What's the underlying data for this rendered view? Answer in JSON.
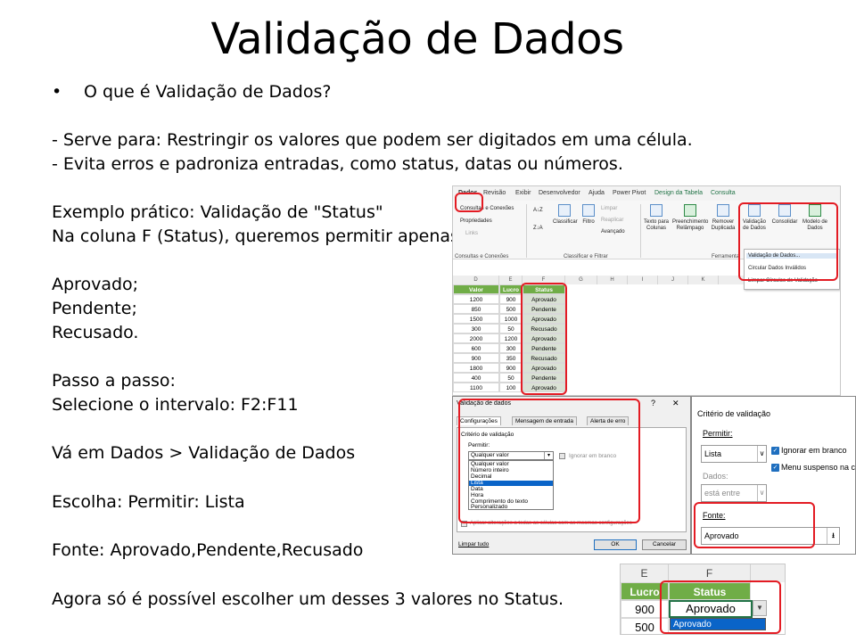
{
  "slide": {
    "title": "Validação de Dados",
    "bullet": "O que é Validação de Dados?",
    "lines": [
      "- Serve para: Restringir os valores que podem ser digitados em uma célula.",
      "- Evita erros e padroniza entradas, como status, datas ou números.",
      "Exemplo prático: Validação de \"Status\"",
      "Na coluna F (Status), queremos permitir apenas:",
      "Aprovado;",
      "Pendente;",
      "Recusado.",
      "Passo a passo:",
      "Selecione o intervalo: F2:F11",
      "Vá em Dados > Validação de Dados",
      "Escolha: Permitir: Lista",
      "Fonte: Aprovado,Pendente,Recusado",
      "Agora só é possível escolher um desses 3 valores no Status."
    ]
  },
  "ribbon": {
    "tabs": [
      "Dados",
      "Revisão",
      "Exibir",
      "Desenvolvedor",
      "Ajuda",
      "Power Pivot",
      "Design da Tabela",
      "Consulta"
    ],
    "items": {
      "consultas": "Consultas e Conexões",
      "propriedades": "Propriedades",
      "links": "Links",
      "classificar": "Classificar",
      "filtro": "Filtro",
      "limpar": "Limpar",
      "reaplicar": "Reaplicar",
      "avancado": "Avançado",
      "texto_colunas": "Texto para Colunas",
      "preenchimento": "Preenchimento Relâmpago",
      "remover": "Remover Duplicada",
      "validacao": "Validação de Dados",
      "consolidar": "Consolidar",
      "modelo": "Modelo de Dados",
      "sort_az": "A↓Z",
      "sort_za": "Z↓A"
    },
    "groups": {
      "consultas": "Consultas e Conexões",
      "classificar": "Classificar e Filtrar",
      "ferramentas": "Ferramenta"
    },
    "dropdown": [
      "Validação de Dados...",
      "Circular Dados Inválidos",
      "Limpar Círculos de Validação"
    ]
  },
  "sheet": {
    "columns": [
      "D",
      "E",
      "F",
      "G",
      "H",
      "I",
      "J",
      "K",
      "L"
    ],
    "headers": [
      "Valor",
      "Lucro",
      "Status"
    ],
    "rows": [
      [
        "1200",
        "900",
        "Aprovado"
      ],
      [
        "850",
        "500",
        "Pendente"
      ],
      [
        "1500",
        "1000",
        "Aprovado"
      ],
      [
        "300",
        "50",
        "Recusado"
      ],
      [
        "2000",
        "1200",
        "Aprovado"
      ],
      [
        "600",
        "300",
        "Pendente"
      ],
      [
        "900",
        "350",
        "Recusado"
      ],
      [
        "1800",
        "900",
        "Aprovado"
      ],
      [
        "400",
        "50",
        "Pendente"
      ],
      [
        "1100",
        "100",
        "Aprovado"
      ]
    ]
  },
  "dialog": {
    "title": "Validação de dados",
    "help": "?",
    "close": "✕",
    "tabs": [
      "Configurações",
      "Mensagem de entrada",
      "Alerta de erro"
    ],
    "criteria": "Critério de validação",
    "allow_label": "Permitir:",
    "allow_value": "Qualquer valor",
    "options": [
      "Qualquer valor",
      "Número inteiro",
      "Decimal",
      "Lista",
      "Data",
      "Hora",
      "Comprimento do texto",
      "Personalizado"
    ],
    "selected_option": "Lista",
    "ignore_blank": "Ignorar em branco",
    "apply_all": "Aplicar alterações a todas as células com as mesmas configurações",
    "clear_all": "Limpar tudo",
    "ok": "OK",
    "cancel": "Cancelar"
  },
  "criteria_zoom": {
    "title": "Critério de validação",
    "allow_label": "Permitir:",
    "allow_value": "Lista",
    "ignore_blank": "Ignorar em branco",
    "dropdown_menu": "Menu suspenso na célula",
    "data_label": "Dados:",
    "data_value": "está entre",
    "source_label": "Fonte:",
    "source_value": "Aprovado"
  },
  "cell_dropdown": {
    "col_e": "E",
    "col_f": "F",
    "hdr_lucro": "Lucro",
    "hdr_status": "Status",
    "row1_e": "900",
    "row1_f": "Aprovado",
    "row2_e": "500",
    "dropdown_item": "Aprovado"
  },
  "colors": {
    "accent_red": "#e31b23",
    "excel_green": "#70ad47",
    "selection_blue": "#0a64c8"
  }
}
